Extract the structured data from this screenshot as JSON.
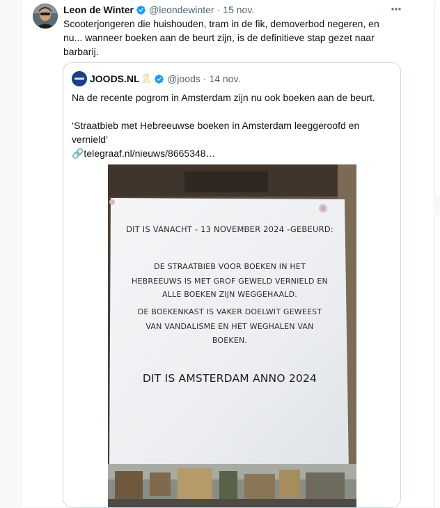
{
  "tweet": {
    "author_name": "Leon de Winter",
    "author_handle": "@leondewinter",
    "date": "15 nov.",
    "separator": "·",
    "text": "Scooterjongeren die huishouden, tram in de fik, demoverbod negeren, en nu... wanneer boeken aan de beurt zijn, is de definitieve stap gezet naar barbarij."
  },
  "quote": {
    "author_name": "JOODS.NL",
    "author_handle": "@joods",
    "date": "14 nov.",
    "separator": "·",
    "ribbon": "🎗",
    "line1": "Na de recente pogrom in Amsterdam zijn nu ook boeken aan de beurt.",
    "line2": "‘Straatbieb met Hebreeuwse boeken in Amsterdam leeggeroofd en vernield’",
    "link": "🔗telegraaf.nl/nieuws/8665348…"
  },
  "sign": {
    "line1": "DIT IS VANACHT - 13 NOVEMBER 2024 -GEBEURD:",
    "para1_line1": "DE  STRAATBIEB VOOR BOEKEN IN HET",
    "para1_line2": "HEBREEUWS IS MET GROF GEWELD VERNIELD EN",
    "para1_line3": "ALLE BOEKEN ZIJN WEGGEHAALD.",
    "para2_line1": "DE BOEKENKAST IS VAKER DOELWIT GEWEEST",
    "para2_line2": "VAN  VANDALISME EN HET WEGHALEN VAN",
    "para2_line3": "BOEKEN.",
    "headline": "DIT IS AMSTERDAM ANNO 2024"
  },
  "colors": {
    "verified": "#1d9bf0",
    "text": "#0f1419",
    "secondary": "#536471",
    "border": "#cfd9de"
  },
  "icons": {
    "verified": "verified-badge-icon",
    "more": "more-options-icon",
    "link": "link-icon"
  }
}
